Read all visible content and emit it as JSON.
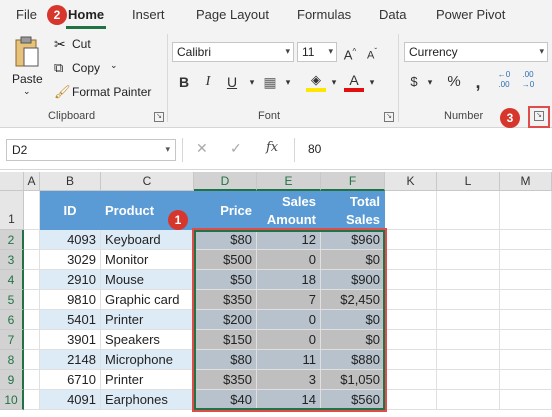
{
  "tabs": [
    "File",
    "Home",
    "Insert",
    "Page Layout",
    "Formulas",
    "Data",
    "Power Pivot"
  ],
  "ribbon": {
    "clipboard": {
      "paste": "Paste",
      "cut": "Cut",
      "copy": "Copy",
      "format_painter": "Format Painter",
      "label": "Clipboard"
    },
    "font": {
      "family": "Calibri",
      "size": "11",
      "label": "Font"
    },
    "number": {
      "format": "Currency",
      "label": "Number"
    }
  },
  "formula_bar": {
    "name_box": "D2",
    "formula": "80"
  },
  "columns": [
    "A",
    "B",
    "C",
    "D",
    "E",
    "F",
    "K",
    "L",
    "M"
  ],
  "table": {
    "headers": {
      "id": "ID",
      "product": "Product",
      "price": "Price",
      "sales_amount": "Sales Amount",
      "total_sales": "Total Sales"
    },
    "rows": [
      {
        "row": "2",
        "id": "4093",
        "product": "Keyboard",
        "price": "$80",
        "sales": "12",
        "total": "$960"
      },
      {
        "row": "3",
        "id": "3029",
        "product": "Monitor",
        "price": "$500",
        "sales": "0",
        "total": "$0"
      },
      {
        "row": "4",
        "id": "2910",
        "product": "Mouse",
        "price": "$50",
        "sales": "18",
        "total": "$900"
      },
      {
        "row": "5",
        "id": "9810",
        "product": "Graphic card",
        "price": "$350",
        "sales": "7",
        "total": "$2,450"
      },
      {
        "row": "6",
        "id": "5401",
        "product": "Printer",
        "price": "$200",
        "sales": "0",
        "total": "$0"
      },
      {
        "row": "7",
        "id": "3901",
        "product": "Speakers",
        "price": "$150",
        "sales": "0",
        "total": "$0"
      },
      {
        "row": "8",
        "id": "2148",
        "product": "Microphone",
        "price": "$80",
        "sales": "11",
        "total": "$880"
      },
      {
        "row": "9",
        "id": "6710",
        "product": "Printer",
        "price": "$350",
        "sales": "3",
        "total": "$1,050"
      },
      {
        "row": "10",
        "id": "4091",
        "product": "Earphones",
        "price": "$40",
        "sales": "14",
        "total": "$560"
      }
    ]
  },
  "header_row": "1",
  "badges": [
    "1",
    "2",
    "3"
  ],
  "colors": {
    "accent": "#217346",
    "table_header": "#5b9bd5",
    "band": "#ddebf7",
    "badge": "#d6362c"
  }
}
